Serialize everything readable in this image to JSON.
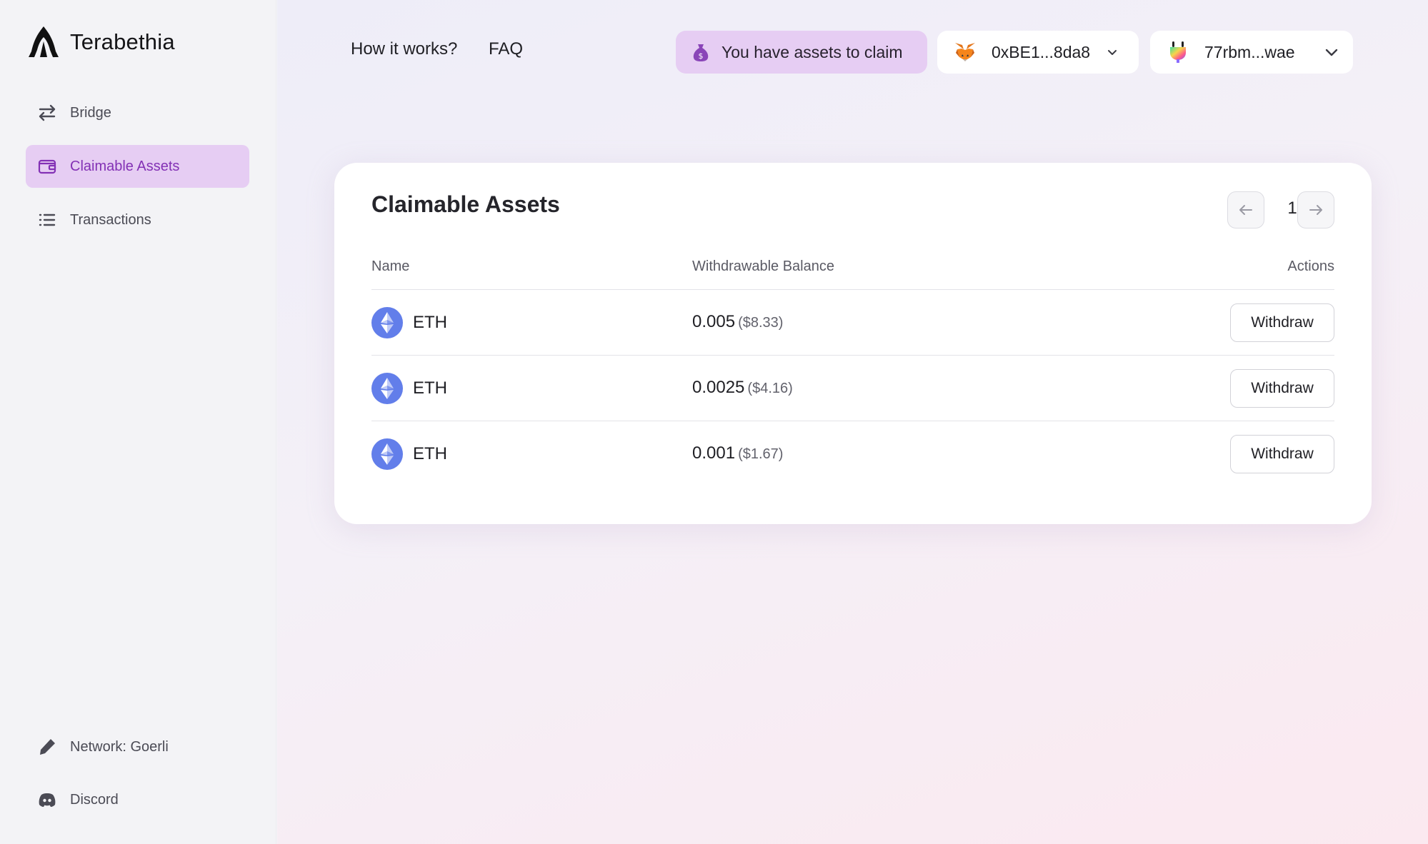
{
  "app": {
    "name": "Terabethia"
  },
  "sidebar": {
    "items": [
      {
        "label": "Bridge",
        "icon": "arrows-left-right-icon"
      },
      {
        "label": "Claimable Assets",
        "icon": "wallet-icon",
        "active": true
      },
      {
        "label": "Transactions",
        "icon": "list-icon"
      }
    ],
    "footer": [
      {
        "label": "Network: Goerli",
        "icon": "pencil-icon"
      },
      {
        "label": "Discord",
        "icon": "discord-icon"
      }
    ]
  },
  "header": {
    "links": [
      "How it works?",
      "FAQ"
    ],
    "claim_pill": {
      "label": "You have assets to claim",
      "icon": "money-bag-icon"
    },
    "eth_wallet": {
      "address": "0xBE1...8da8",
      "icon": "metamask-fox-icon"
    },
    "ic_wallet": {
      "address": "77rbm...wae",
      "icon": "plug-icon"
    }
  },
  "card": {
    "title": "Claimable Assets",
    "page": "1",
    "columns": [
      "Name",
      "Withdrawable Balance",
      "Actions"
    ],
    "rows": [
      {
        "name": "ETH",
        "amount": "0.005",
        "usd": "($8.33)",
        "action": "Withdraw"
      },
      {
        "name": "ETH",
        "amount": "0.0025",
        "usd": "($4.16)",
        "action": "Withdraw"
      },
      {
        "name": "ETH",
        "amount": "0.001",
        "usd": "($1.67)",
        "action": "Withdraw"
      }
    ]
  },
  "colors": {
    "accent": "#8331b5",
    "accent_bg": "#e6cdf3",
    "eth_blue": "#627eea"
  }
}
